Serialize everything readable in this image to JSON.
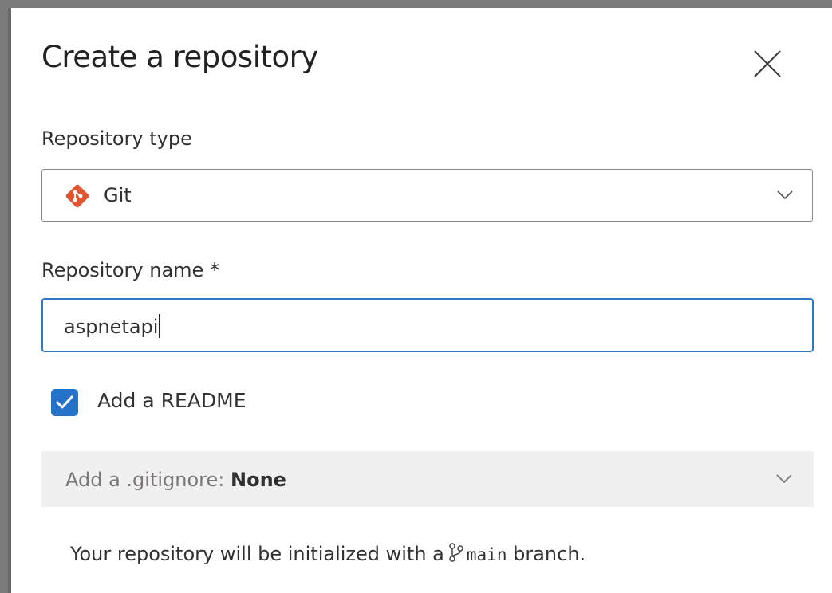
{
  "dialog": {
    "title": "Create a repository"
  },
  "repo_type": {
    "label": "Repository type",
    "selected": "Git",
    "icon": "git-icon",
    "accent": "#e0552f"
  },
  "repo_name": {
    "label": "Repository name *",
    "value": "aspnetapi",
    "focus_color": "#2e79c4"
  },
  "readme": {
    "label": "Add a README",
    "checked": true,
    "color": "#2473c8"
  },
  "gitignore": {
    "prefix": "Add a .gitignore: ",
    "value": "None"
  },
  "info": {
    "before": "Your repository will be initialized with a",
    "branch": "main",
    "after": "branch."
  }
}
